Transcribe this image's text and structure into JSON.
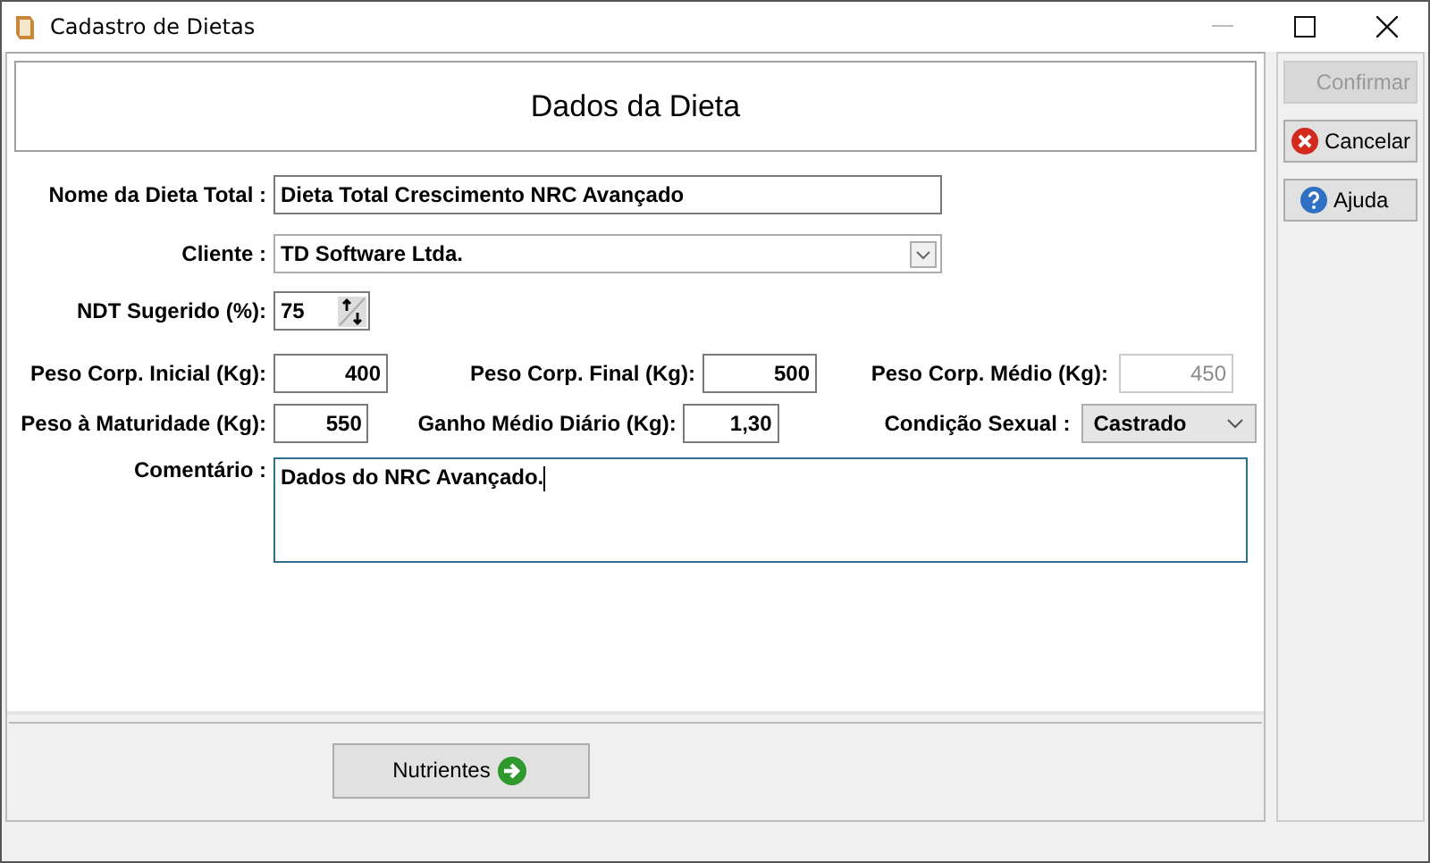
{
  "window": {
    "title": "Cadastro de Dietas"
  },
  "header": {
    "title": "Dados da Dieta"
  },
  "form": {
    "name": {
      "label": "Nome da Dieta Total :",
      "value": "Dieta Total Crescimento NRC Avançado"
    },
    "client": {
      "label": "Cliente :",
      "value": "TD Software Ltda."
    },
    "ndt": {
      "label": "NDT Sugerido (%):",
      "value": "75"
    },
    "grid": [
      [
        {
          "label": "Peso Corp. Inicial (Kg):",
          "value": "400",
          "kind": "number",
          "disabled": false
        },
        {
          "label": "Peso Corp. Final (Kg):",
          "value": "500",
          "kind": "number",
          "disabled": false
        },
        {
          "label": "Peso Corp. Médio (Kg):",
          "value": "450",
          "kind": "number",
          "disabled": true
        }
      ],
      [
        {
          "label": "Peso à Maturidade (Kg):",
          "value": "550",
          "kind": "number",
          "disabled": false
        },
        {
          "label": "Ganho Médio Diário (Kg):",
          "value": "1,30",
          "kind": "number",
          "disabled": false
        },
        {
          "label": "Condição Sexual :",
          "value": "Castrado",
          "kind": "select",
          "disabled": false
        }
      ]
    ],
    "comment": {
      "label": "Comentário :",
      "value": "Dados do NRC Avançado."
    }
  },
  "footer_button": {
    "label": "Nutrientes"
  },
  "side_buttons": [
    {
      "label": "Confirmar",
      "kind": "plain",
      "disabled": true
    },
    {
      "label": "Cancelar",
      "kind": "cancel",
      "disabled": false
    },
    {
      "label": "Ajuda",
      "kind": "help",
      "disabled": false
    }
  ]
}
